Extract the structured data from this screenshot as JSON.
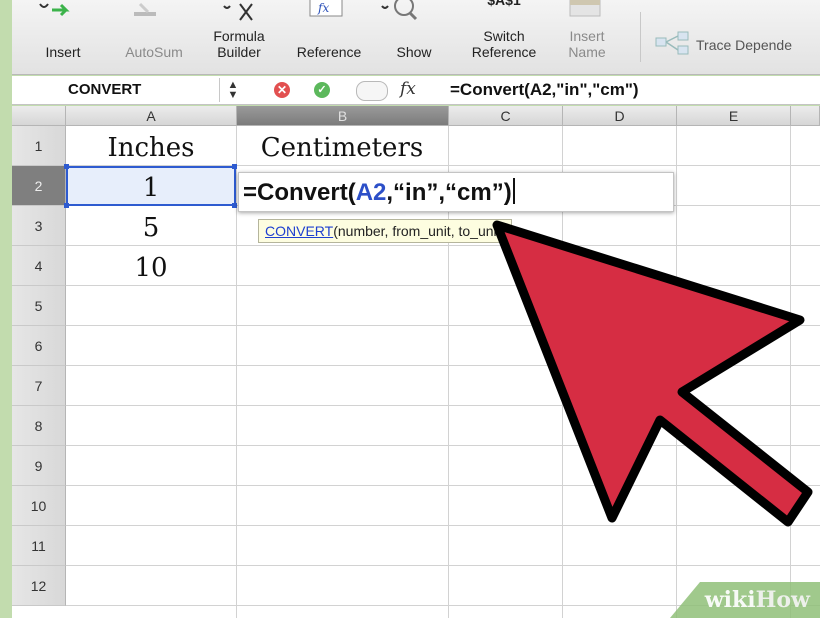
{
  "ribbon": {
    "insert_label": "Insert",
    "autosum_label": "AutoSum",
    "formula_builder_label": "Formula\nBuilder",
    "reference_label": "Reference",
    "show_label": "Show",
    "switch_reference_top": "$A$1",
    "switch_reference_label": "Switch\nReference",
    "insert_name_label": "Insert\nName",
    "trace_dependents_label": "Trace Depende"
  },
  "formula_bar": {
    "name_box": "CONVERT",
    "fx_label": "fx",
    "formula": "=Convert(A2,\"in\",\"cm\")"
  },
  "grid": {
    "columns": [
      "A",
      "B",
      "C",
      "D",
      "E"
    ],
    "selected_column": "B",
    "rows": [
      "1",
      "2",
      "3",
      "4",
      "5",
      "6",
      "7",
      "8",
      "9",
      "10",
      "11",
      "12"
    ],
    "selected_row": "2",
    "cells": {
      "A1": "Inches",
      "B1": "Centimeters",
      "A2": "1",
      "A3": "5",
      "A4": "10"
    },
    "edit": {
      "prefix": "=Convert(",
      "ref": "A2",
      "suffix": ",“in”,“cm”)"
    },
    "tooltip": {
      "function": "CONVERT",
      "args": "(number, from_unit, to_unit)"
    }
  },
  "watermark": {
    "wiki": "wiki",
    "how": "How"
  },
  "colors": {
    "arrow_fill": "#d62d43",
    "arrow_stroke": "#000000",
    "selection_blue": "#2e5bd0",
    "frame_green": "#c2dcae"
  }
}
